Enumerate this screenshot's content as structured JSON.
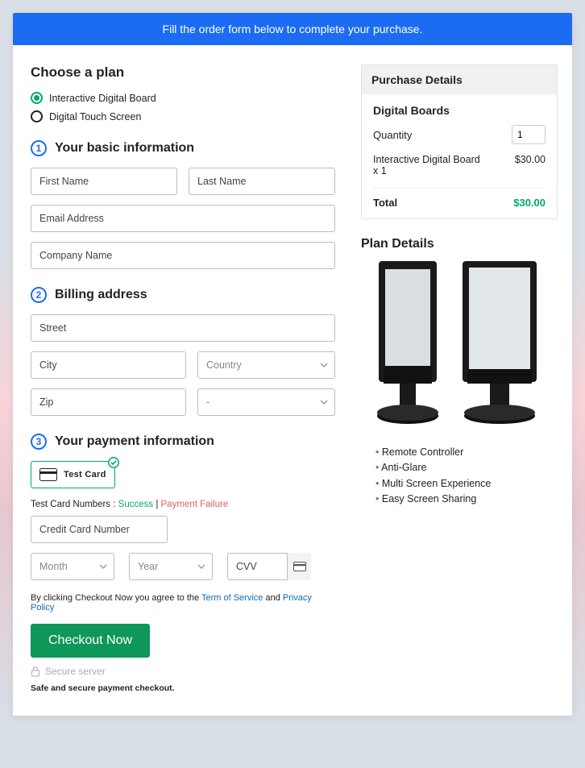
{
  "banner": "Fill the order form below to complete your purchase.",
  "plan": {
    "heading": "Choose a plan",
    "options": [
      "Interactive Digital Board",
      "Digital Touch Screen"
    ],
    "selected": 0
  },
  "sections": {
    "basic": {
      "num": "1",
      "title": "Your basic information"
    },
    "billing": {
      "num": "2",
      "title": "Billing address"
    },
    "payment": {
      "num": "3",
      "title": "Your payment information"
    }
  },
  "fields": {
    "first_name": "First Name",
    "last_name": "Last Name",
    "email": "Email Address",
    "company": "Company Name",
    "street": "Street",
    "city": "City",
    "country": "Country",
    "zip": "Zip",
    "state_dash": "-",
    "cc_number": "Credit Card Number",
    "month": "Month",
    "year": "Year",
    "cvv": "CVV"
  },
  "card_tile_label": "Test Card",
  "testnums": {
    "prefix": "Test Card Numbers :",
    "success": "Success",
    "sep": " | ",
    "failure": "Payment Failure"
  },
  "agree": {
    "prefix": "By clicking Checkout Now you agree to the ",
    "tos": "Term of Service",
    "and": " and ",
    "pp": "Privacy Policy"
  },
  "checkout_label": "Checkout Now",
  "secure_label": "Secure server",
  "safe_note": "Safe and secure payment checkout.",
  "purchase": {
    "header": "Purchase Details",
    "section_name": "Digital Boards",
    "quantity_label": "Quantity",
    "quantity_value": "1",
    "line_label": "Interactive Digital Board x 1",
    "line_price": "$30.00",
    "total_label": "Total",
    "total_value": "$30.00"
  },
  "plan_details": {
    "heading": "Plan Details",
    "features": [
      "Remote Controller",
      "Anti-Glare",
      "Multi Screen Experience",
      "Easy Screen Sharing"
    ]
  }
}
